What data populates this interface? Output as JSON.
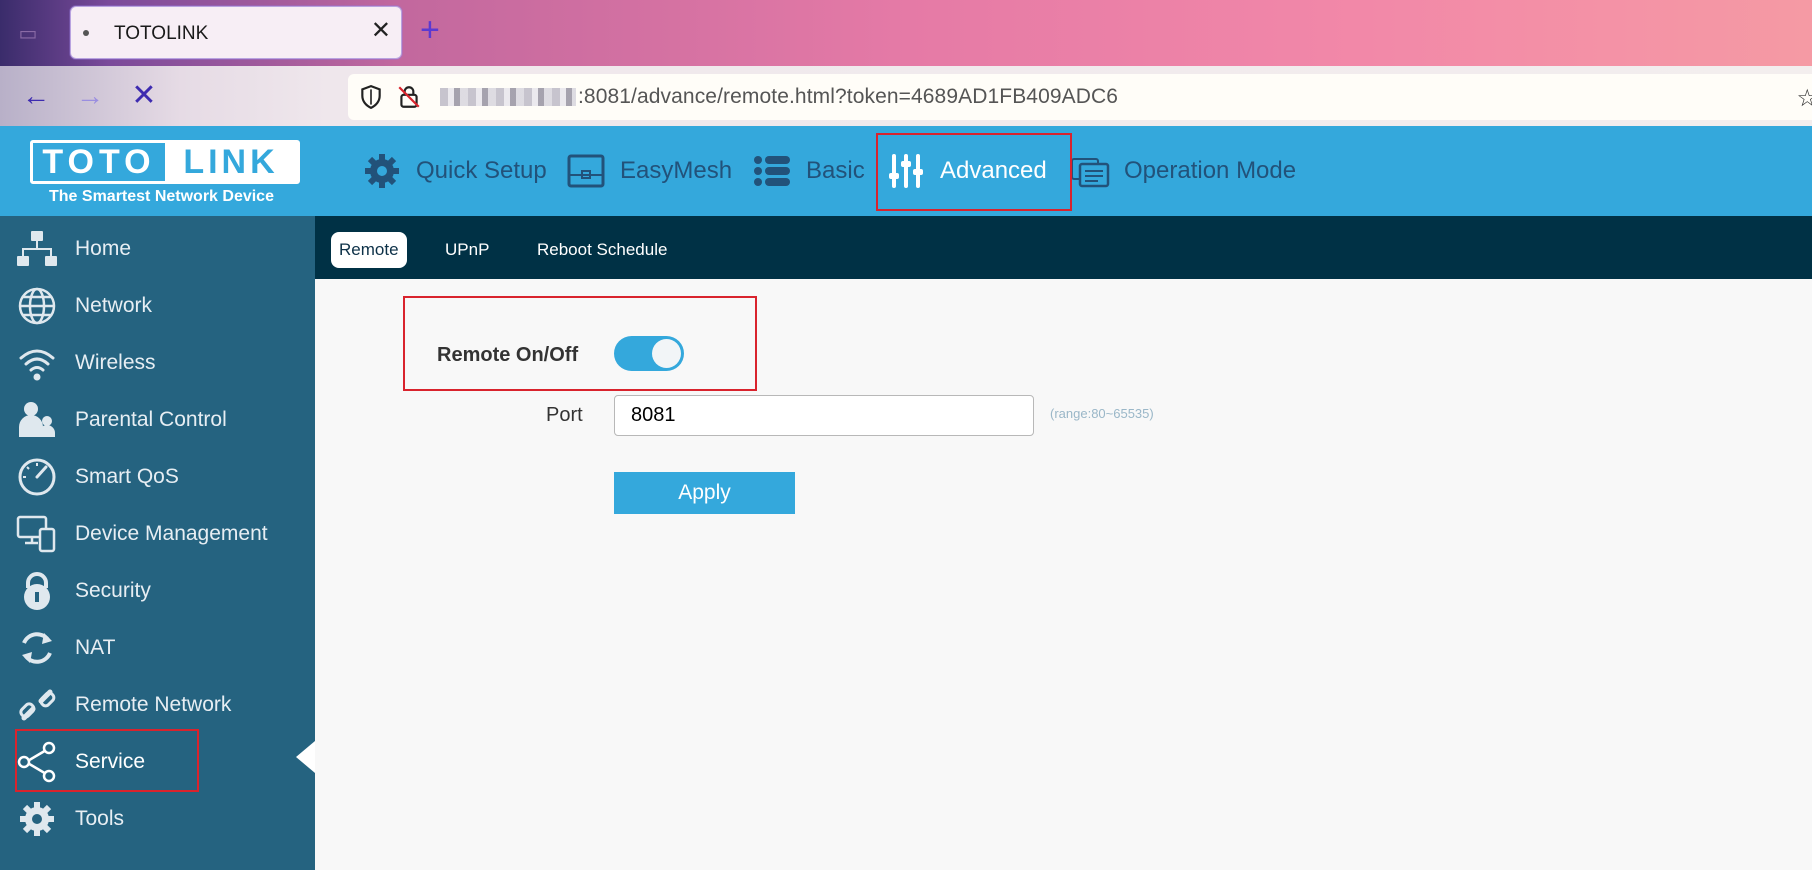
{
  "browser": {
    "tab_title": "TOTOLINK",
    "url_suffix": ":8081/advance/remote.html?token=4689AD1FB409ADC6"
  },
  "header": {
    "logo_left": "TOTO",
    "logo_right": "LINK",
    "logo_tagline": "The Smartest Network Device",
    "nav": [
      {
        "label": "Quick Setup",
        "icon": "gear-icon"
      },
      {
        "label": "EasyMesh",
        "icon": "mesh-router-icon"
      },
      {
        "label": "Basic",
        "icon": "list-icon"
      },
      {
        "label": "Advanced",
        "icon": "sliders-icon",
        "active": true
      },
      {
        "label": "Operation Mode",
        "icon": "mode-cards-icon"
      }
    ]
  },
  "sidebar": {
    "items": [
      {
        "label": "Home",
        "icon": "network-tree-icon"
      },
      {
        "label": "Network",
        "icon": "globe-icon"
      },
      {
        "label": "Wireless",
        "icon": "wifi-icon"
      },
      {
        "label": "Parental Control",
        "icon": "parent-child-icon"
      },
      {
        "label": "Smart QoS",
        "icon": "speedometer-icon"
      },
      {
        "label": "Device Management",
        "icon": "devices-icon"
      },
      {
        "label": "Security",
        "icon": "lock-icon"
      },
      {
        "label": "NAT",
        "icon": "refresh-icon"
      },
      {
        "label": "Remote Network",
        "icon": "link-icon"
      },
      {
        "label": "Service",
        "icon": "share-icon",
        "active": true
      },
      {
        "label": "Tools",
        "icon": "gear-icon"
      }
    ]
  },
  "subnav": {
    "tabs": [
      {
        "label": "Remote",
        "active": true
      },
      {
        "label": "UPnP"
      },
      {
        "label": "Reboot Schedule"
      }
    ]
  },
  "form": {
    "remote_label": "Remote On/Off",
    "remote_enabled": true,
    "port_label": "Port",
    "port_value": "8081",
    "port_hint": "(range:80~65535)",
    "apply_label": "Apply"
  },
  "colors": {
    "brand_blue": "#34a8dc",
    "sidebar": "#256380",
    "subnav": "#003145",
    "highlight_red": "#d9232d"
  }
}
